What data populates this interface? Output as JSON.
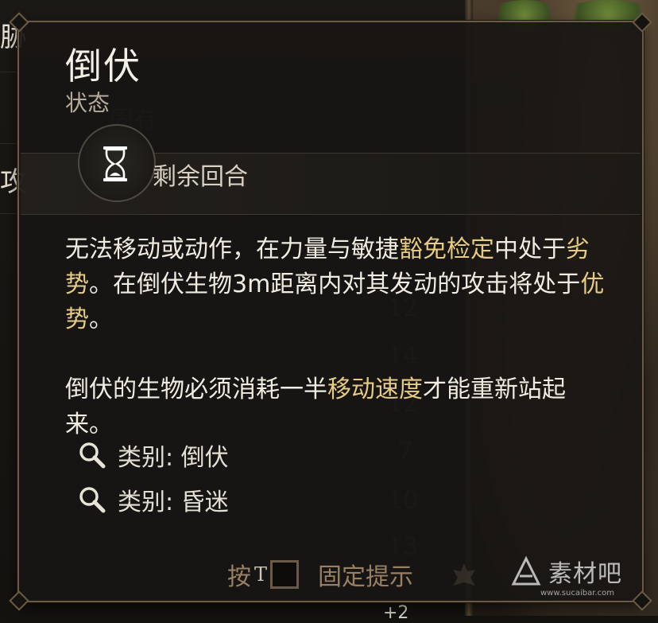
{
  "background": {
    "left_text_1": "胁",
    "left_text_2": "攻",
    "ghost_label": "固有",
    "ghost_attack": "击",
    "ghost_numbers": [
      "12",
      "14",
      "12",
      "7",
      "10",
      "13"
    ],
    "bottom_peek": "+2"
  },
  "tooltip": {
    "title": "倒伏",
    "subtitle": "状态",
    "duration": {
      "icon": "hourglass-icon",
      "label": "剩余回合"
    },
    "paragraph1": {
      "t1": "无法移动或动作，在力量与敏捷",
      "kw1": "豁免检定",
      "t2": "中处于",
      "kw2": "劣势",
      "t3": "。在倒伏生物3m距离内对其发动的攻击将处于",
      "kw3": "优势",
      "t4": "。"
    },
    "paragraph2": {
      "t1": "倒伏的生物必须消耗一半",
      "kw1": "移动速度",
      "t2": "才能重新站起来。"
    },
    "categories": [
      {
        "icon": "magnifier-icon",
        "label": "类别: 倒伏"
      },
      {
        "icon": "magnifier-icon",
        "label": "类别: 昏迷"
      }
    ],
    "hint": {
      "prefix": "按",
      "key": "T",
      "action": "固定提示"
    }
  },
  "watermark": {
    "name": "素材吧",
    "url": "www.sucaibar.com"
  },
  "colors": {
    "keyword": "#e6cc82",
    "text": "#f1ece2",
    "border": "#6b5a44",
    "hint": "#9a8063"
  }
}
